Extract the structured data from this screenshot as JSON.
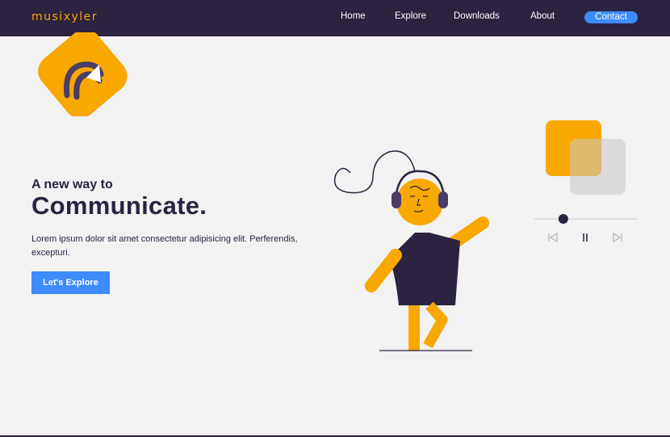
{
  "brand": {
    "name": "musixyler"
  },
  "nav": {
    "home": "Home",
    "explore": "Explore",
    "downloads": "Downloads",
    "about": "About",
    "contact": "Contact"
  },
  "hero": {
    "subtitle": "A new way to",
    "title": "Communicate.",
    "description": "Lorem ipsum dolor sit amet consectetur adipisicing elit. Perferendis, excepturi.",
    "cta": "Let's Explore"
  },
  "player": {
    "progress": 0.28,
    "controls": [
      "previous-icon",
      "pause-icon",
      "next-icon"
    ]
  },
  "colors": {
    "navbar": "#2b2340",
    "accent": "#f9a800",
    "button": "#3d8bfd",
    "background": "#f2f2f2"
  }
}
